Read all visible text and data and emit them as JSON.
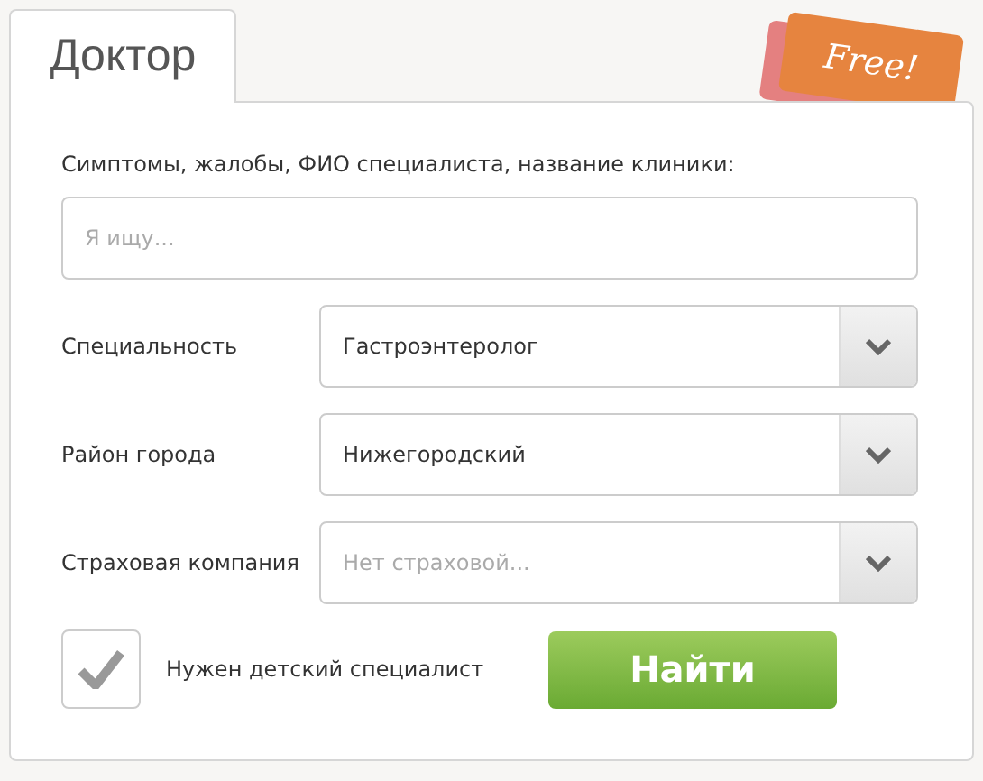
{
  "tab": {
    "label": "Доктор",
    "selected": true
  },
  "badge": {
    "label": "Free!"
  },
  "query": {
    "label": "Симптомы, жалобы, ФИО специалиста, название клиники:",
    "placeholder": "Я ищу..."
  },
  "filters": [
    {
      "label": "Специальность",
      "kind": "value",
      "text": "Гастроэнтеролог"
    },
    {
      "label": "Район города",
      "kind": "value",
      "text": "Нижегородский"
    },
    {
      "label": "Страховая компания",
      "kind": "placeholder",
      "text": "Нет страховой..."
    }
  ],
  "child_specialist": {
    "label": "Нужен детский специалист",
    "checked": true
  },
  "search_button": {
    "label": "Найти"
  }
}
